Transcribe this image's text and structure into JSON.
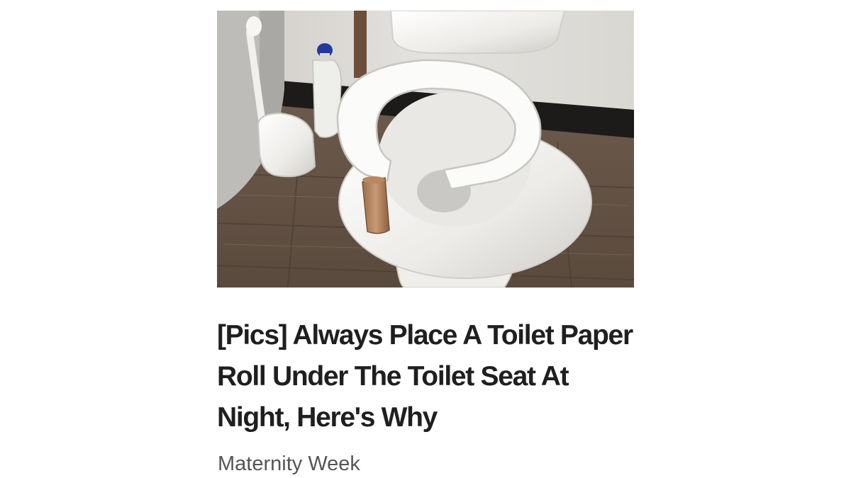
{
  "ad": {
    "image_icon": "toilet-photo",
    "headline": "[Pics] Always Place A Toilet Paper Roll Under The Toilet Seat At Night, Here's Why",
    "source": "Maternity Week"
  },
  "colors": {
    "background": "#ffffff",
    "headline_text": "#1f1f1f",
    "source_text": "#555555"
  }
}
